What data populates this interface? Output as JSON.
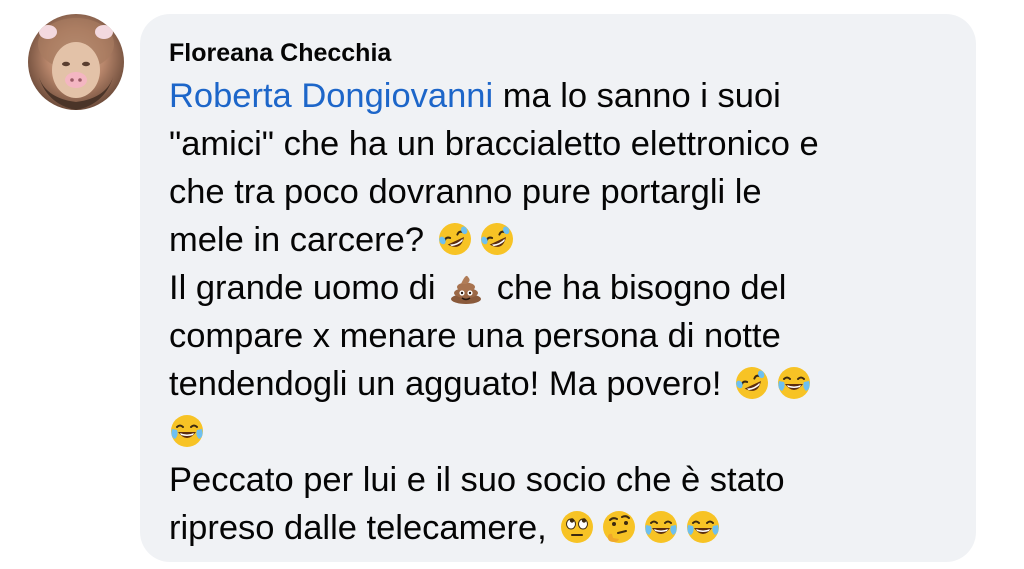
{
  "comment": {
    "author": "Floreana Checchia",
    "mention": "Roberta Dongiovanni",
    "lines": [
      " ma lo sanno i suoi",
      "\"amici\" che ha un braccialetto elettronico e",
      "che tra poco dovranno pure portargli le",
      "mele in carcere? ",
      "Il grande uomo di ",
      " che ha bisogno del",
      "compare x menare una persona di notte",
      "tendendogli un agguato! Ma povero! ",
      "Peccato per lui e il suo socio che è stato",
      "ripreso dalle telecamere, "
    ],
    "emojis": {
      "rolling_laughing": "rolling-on-the-floor-laughing-emoji",
      "tears_of_joy": "face-with-tears-of-joy-emoji",
      "poop": "pile-of-poo-emoji",
      "eye_roll": "face-with-rolling-eyes-emoji",
      "thinking": "thinking-face-emoji"
    }
  },
  "colors": {
    "bubble_background": "#f0f2f5",
    "mention": "#1d66c9",
    "text": "#050505"
  }
}
